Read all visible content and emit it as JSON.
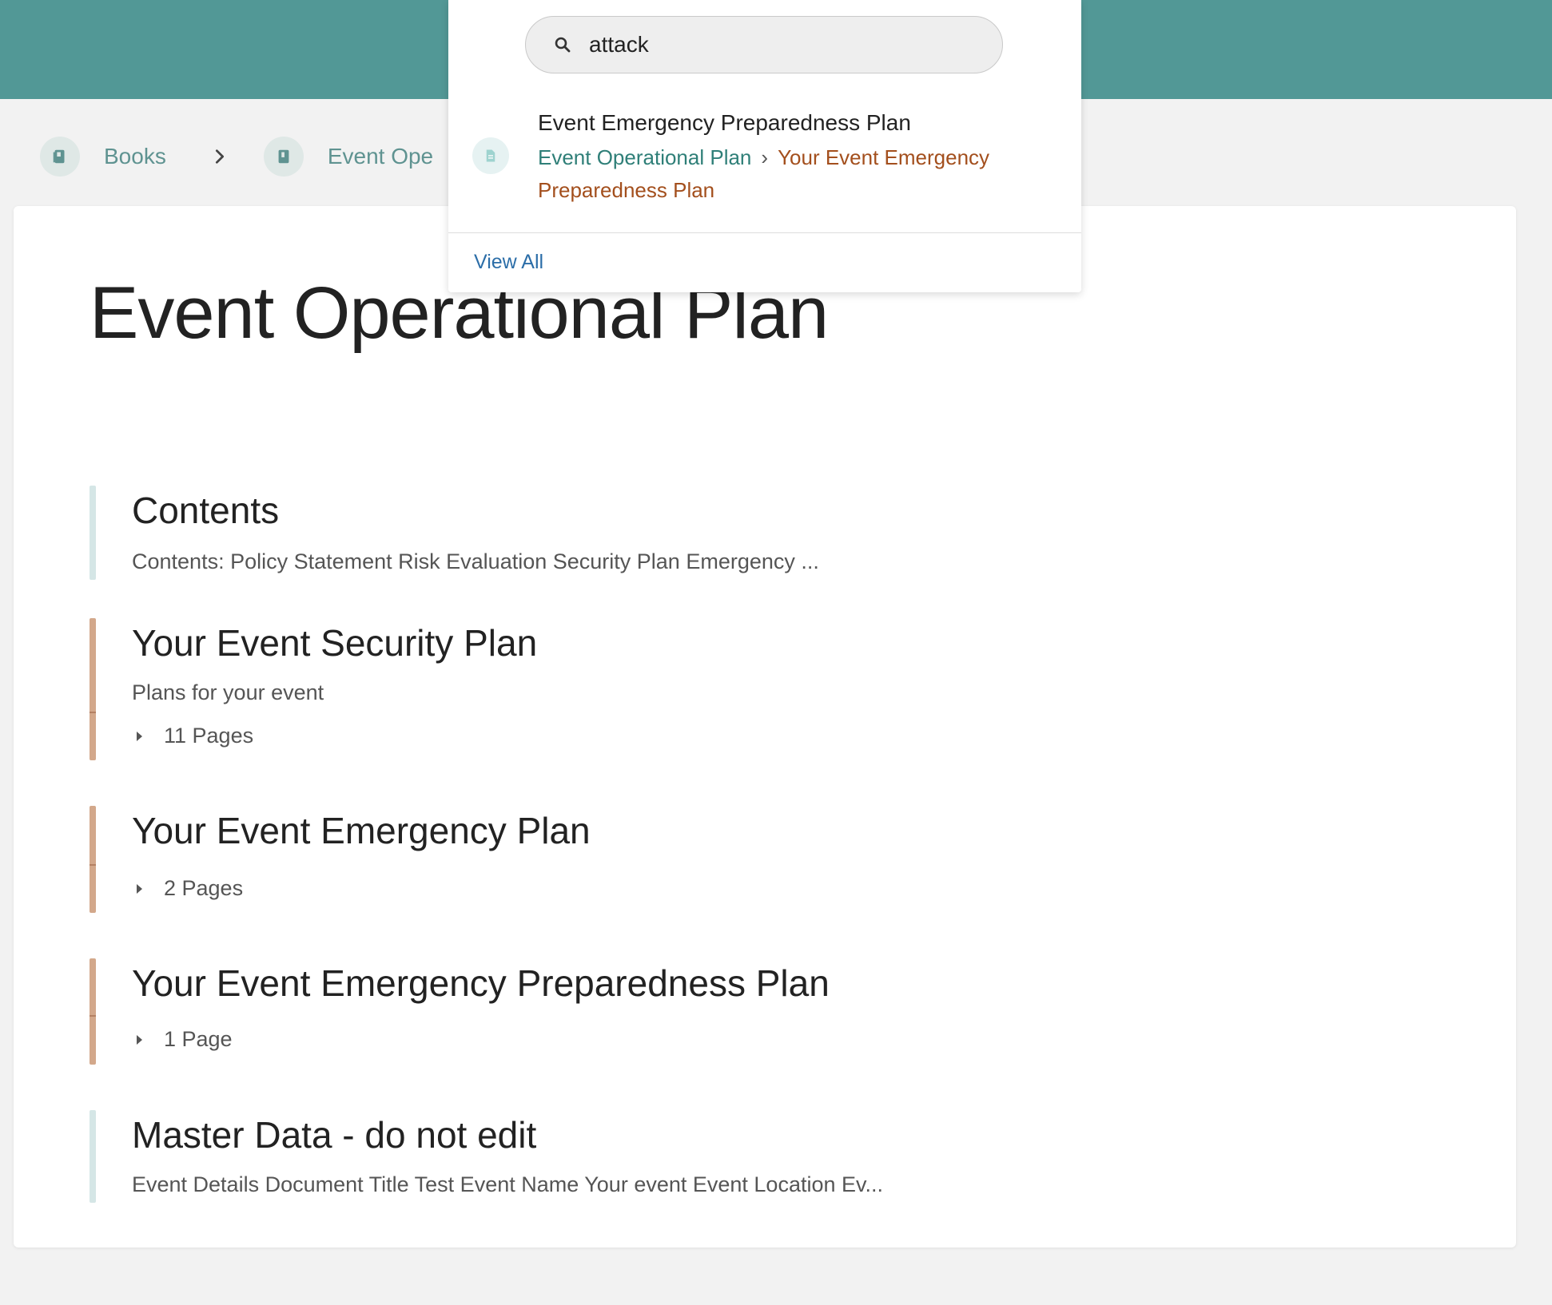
{
  "breadcrumbs": [
    {
      "label": "Books",
      "icon": "books-icon"
    },
    {
      "label": "Event Ope",
      "icon": "book-icon"
    }
  ],
  "book": {
    "title": "Event Operational Plan"
  },
  "entries": [
    {
      "type": "page",
      "title": "Contents",
      "description": "Contents: Policy Statement Risk Evaluation Security Plan Emergency ..."
    },
    {
      "type": "chapter",
      "title": "Your Event Security Plan",
      "description": "Plans for your event",
      "pages": "11 Pages"
    },
    {
      "type": "chapter",
      "title": "Your Event Emergency Plan",
      "pages": "2 Pages"
    },
    {
      "type": "chapter",
      "title": "Your Event Emergency Preparedness Plan",
      "pages": "1 Page"
    },
    {
      "type": "page",
      "title": "Master Data - do not edit",
      "description": "Event Details Document Title Test Event Name Your event Event Location Ev..."
    }
  ],
  "search": {
    "query": "attack",
    "results": [
      {
        "title": "Event Emergency Preparedness Plan",
        "book": "Event Operational Plan",
        "separator": "›",
        "chapter": "Your Event Emergency Preparedness Plan",
        "icon": "page-icon"
      }
    ],
    "view_all_label": "View All"
  },
  "colors": {
    "header": "#529896",
    "chapter_accent": "#d3a88b",
    "page_accent": "#d5e6e6",
    "book_link": "#2f7f78",
    "chapter_link": "#a34f1d",
    "link": "#2c6ea8"
  }
}
